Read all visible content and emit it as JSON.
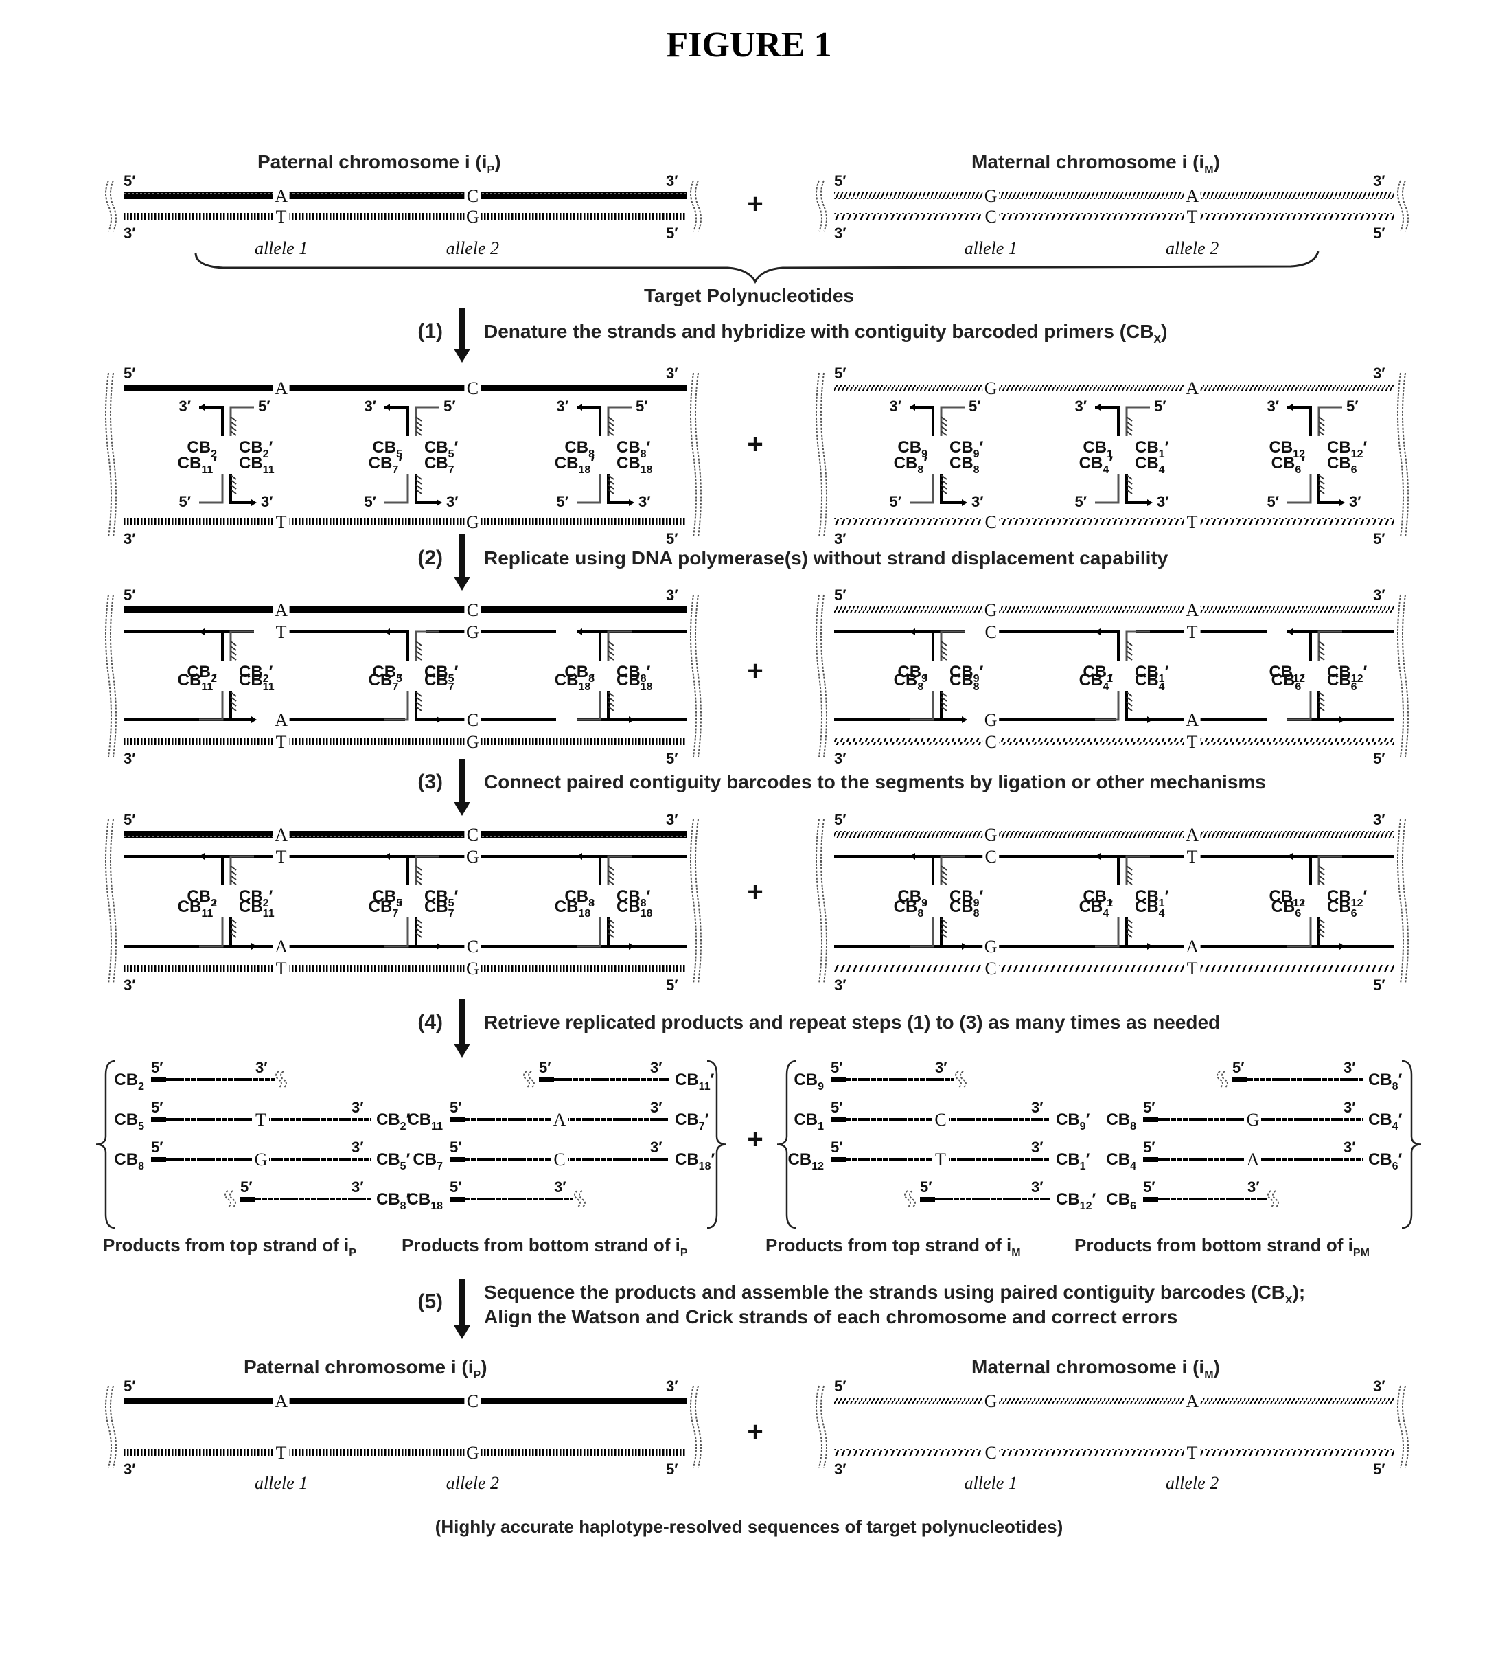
{
  "figure_title": "FIGURE 1",
  "paternal_header": "Paternal chromosome i (i",
  "paternal_sub": "P",
  "maternal_header": "Maternal chromosome i (i",
  "maternal_sub": "M",
  "prime5": "5′",
  "prime3": "3′",
  "allele1": "allele 1",
  "allele2": "allele 2",
  "plus": "+",
  "target_label": "Target Polynucleotides",
  "paternal": {
    "top_bases": [
      "A",
      "C"
    ],
    "bottom_bases": [
      "T",
      "G"
    ]
  },
  "maternal": {
    "top_bases": [
      "G",
      "A"
    ],
    "bottom_bases": [
      "C",
      "T"
    ]
  },
  "steps": [
    {
      "num": "(1)",
      "text": "Denature the strands and hybridize with contiguity barcoded primers (CB",
      "sub": "X",
      "tail": ")"
    },
    {
      "num": "(2)",
      "text": "Replicate using DNA polymerase(s) without strand displacement capability",
      "sub": "",
      "tail": ""
    },
    {
      "num": "(3)",
      "text": "Connect paired contiguity barcodes to the segments by ligation or other mechanisms",
      "sub": "",
      "tail": ""
    },
    {
      "num": "(4)",
      "text": "Retrieve replicated products and repeat steps (1) to (3) as many times as needed",
      "sub": "",
      "tail": ""
    },
    {
      "num": "(5)",
      "text": "Sequence the products and assemble the strands using paired contiguity barcodes (CB",
      "sub": "X",
      "tail": ");",
      "line2": "Align the Watson and Crick strands of each chromosome and correct errors"
    }
  ],
  "barcodes": {
    "paternal_top": [
      [
        "2",
        "2"
      ],
      [
        "5",
        "5"
      ],
      [
        "8",
        "8"
      ]
    ],
    "paternal_bottom": [
      [
        "11",
        "11"
      ],
      [
        "7",
        "7"
      ],
      [
        "18",
        "18"
      ]
    ],
    "maternal_top": [
      [
        "9",
        "9"
      ],
      [
        "1",
        "1"
      ],
      [
        "12",
        "12"
      ]
    ],
    "maternal_bottom": [
      [
        "8",
        "8"
      ],
      [
        "4",
        "4"
      ],
      [
        "6",
        "6"
      ]
    ]
  },
  "products": {
    "paternal_top_caption": "Products from top strand of i",
    "paternal_top_caption_sub": "P",
    "paternal_bottom_caption": "Products from bottom strand of i",
    "paternal_bottom_caption_sub": "P",
    "maternal_top_caption": "Products from top strand of i",
    "maternal_top_caption_sub": "M",
    "maternal_bottom_caption": "Products from bottom strand of i",
    "maternal_bottom_caption_sub": "PM",
    "paternal_top": [
      {
        "left": "2",
        "base": "",
        "right": "",
        "open_end": "right"
      },
      {
        "left": "5",
        "base": "T",
        "right": "2"
      },
      {
        "left": "8",
        "base": "G",
        "right": "5"
      },
      {
        "left": "",
        "base": "",
        "right": "8",
        "open_end": "left"
      }
    ],
    "paternal_bottom": [
      {
        "left": "",
        "base": "",
        "right": "11",
        "open_end": "left"
      },
      {
        "left": "11",
        "base": "A",
        "right": "7"
      },
      {
        "left": "7",
        "base": "C",
        "right": "18"
      },
      {
        "left": "18",
        "base": "",
        "right": "",
        "open_end": "right"
      }
    ],
    "maternal_top": [
      {
        "left": "9",
        "base": "",
        "right": "",
        "open_end": "right"
      },
      {
        "left": "1",
        "base": "C",
        "right": "9"
      },
      {
        "left": "12",
        "base": "T",
        "right": "1"
      },
      {
        "left": "",
        "base": "",
        "right": "12",
        "open_end": "left"
      }
    ],
    "maternal_bottom": [
      {
        "left": "",
        "base": "",
        "right": "8",
        "open_end": "left"
      },
      {
        "left": "8",
        "base": "G",
        "right": "4"
      },
      {
        "left": "4",
        "base": "A",
        "right": "6"
      },
      {
        "left": "6",
        "base": "",
        "right": "",
        "open_end": "right"
      }
    ]
  },
  "final_caption": "(Highly accurate haplotype-resolved sequences of target polynucleotides)"
}
